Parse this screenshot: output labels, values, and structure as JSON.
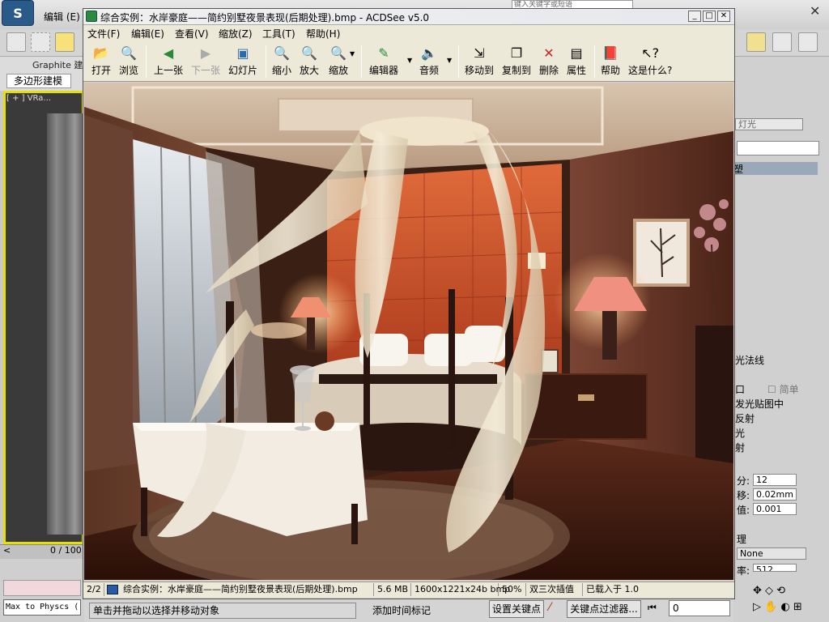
{
  "max": {
    "menu_edit": "编辑 (E)",
    "help_box": "键入关键字或短语",
    "ribbon_tab": "Graphite 建",
    "ribbon_sub": "多边形建模",
    "viewport_label": "[ + ] VRa...",
    "timeline": "0 / 100",
    "maxscript": "Max to Physcs (",
    "status_prompt": "单击并拖动以选择并移动对象",
    "add_time_tag": "添加时间标记",
    "set_key": "设置关键点",
    "key_filters": "关键点过滤器...",
    "frame": "0",
    "right_panel": {
      "light_field": "灯光",
      "sel_item": "塑",
      "normals": "光法线",
      "simple_label": "简单",
      "rows": [
        "口",
        "发光贴图中",
        "反射",
        "光",
        "射"
      ],
      "seg_label": "分:",
      "seg_value": "12",
      "offset_label": "移:",
      "offset_value": "0.02mm",
      "thresh_label": "值:",
      "thresh_value": "0.001",
      "section": "理",
      "none_label": "None",
      "rate_label": "率:",
      "rate_value": "512"
    }
  },
  "acdsee": {
    "title": "综合实例：水岸豪庭——简约别墅夜景表现(后期处理).bmp - ACDSee v5.0",
    "menu": [
      "文件(F)",
      "编辑(E)",
      "查看(V)",
      "缩放(Z)",
      "工具(T)",
      "帮助(H)"
    ],
    "toolbar": {
      "open": "打开",
      "browse": "浏览",
      "prev": "上一张",
      "next": "下一张",
      "slideshow": "幻灯片",
      "zoom_out": "缩小",
      "zoom_in": "放大",
      "zoom": "缩放",
      "editor": "编辑器",
      "audio": "音频",
      "move_to": "移动到",
      "copy_to": "复制到",
      "delete": "删除",
      "properties": "属性",
      "help": "帮助",
      "whats_this": "这是什么?"
    },
    "status": {
      "index": "2/2",
      "filename": "综合实例：水岸豪庭——简约别墅夜景表现(后期处理).bmp",
      "size": "5.6 MB",
      "dims": "1600x1221x24b bmp",
      "zoom": "50%",
      "filter": "双三次插值",
      "load": "已载入于 1.0"
    }
  },
  "colors": {
    "accent": "#e8e000",
    "wall": "#c2492a",
    "wood": "#5a2a1a"
  }
}
